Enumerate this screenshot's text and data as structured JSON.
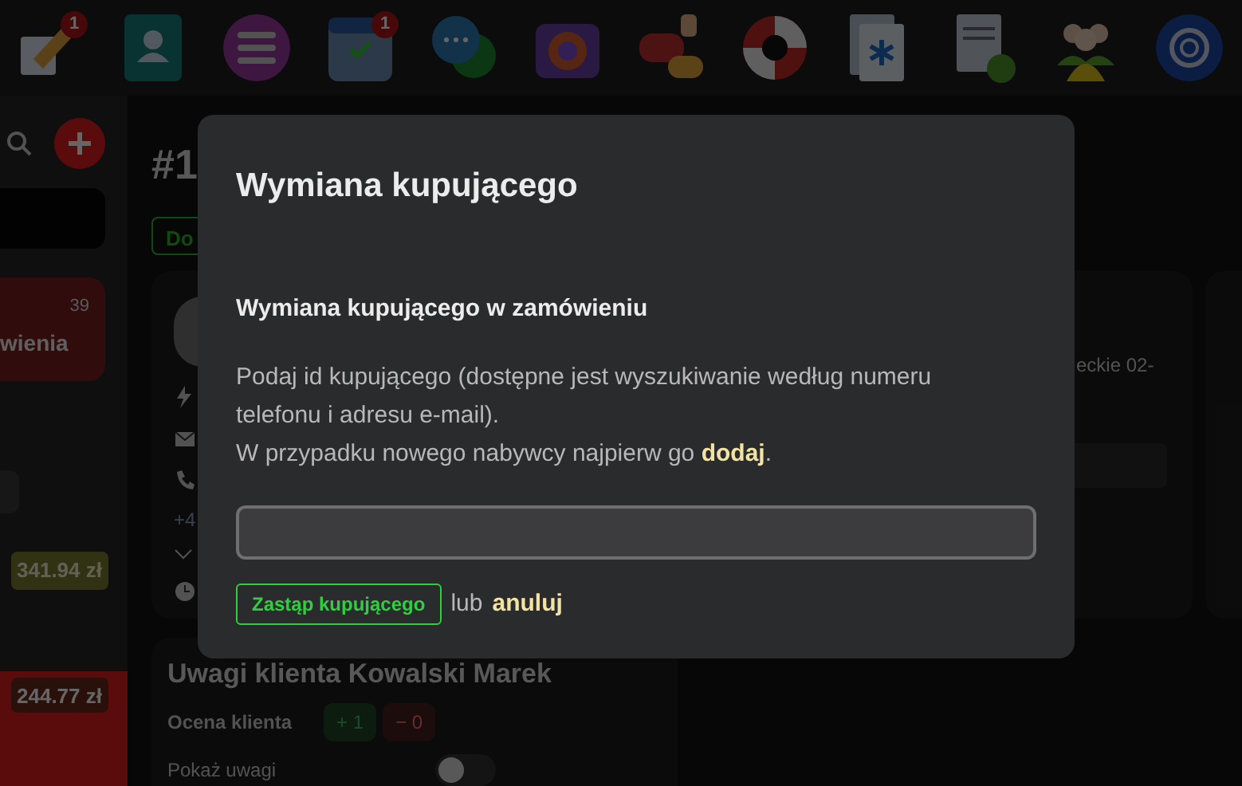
{
  "app_bar": {
    "icons": [
      {
        "kind": "note",
        "badge": "1"
      },
      {
        "kind": "contacts"
      },
      {
        "kind": "menu"
      },
      {
        "kind": "calendar",
        "badge": "1"
      },
      {
        "kind": "chat"
      },
      {
        "kind": "camera"
      },
      {
        "kind": "feedback"
      },
      {
        "kind": "lifebuoy"
      },
      {
        "kind": "document"
      },
      {
        "kind": "refresh"
      },
      {
        "kind": "people"
      },
      {
        "kind": "knot"
      }
    ]
  },
  "sidebar": {
    "order_card": {
      "count": "39",
      "label": "wienia"
    },
    "amount_1": "341.94 zł",
    "amount_2": "244.77 zł"
  },
  "order": {
    "number": "#1",
    "status": "Do",
    "phone": "+4",
    "address": "eckie 02-"
  },
  "customer_notes": {
    "title": "Uwagi klienta Kowalski Marek",
    "rating_label": "Ocena klienta",
    "plus": "+ 1",
    "minus": "− 0",
    "show_label": "Pokaż uwagi",
    "show_on": false
  },
  "dialog": {
    "title": "Wymiana kupującego",
    "subtitle": "Wymiana kupującego w zamówieniu",
    "text_1": "Podaj id kupującego (dostępne jest wyszukiwanie według numeru telefonu i adresu e-mail).",
    "text_2": "W przypadku nowego nabywcy najpierw go",
    "add_link": "dodaj",
    "text_2_end": ".",
    "submit": "Zastąp kupującego",
    "or": "lub",
    "cancel": "anuluj"
  }
}
